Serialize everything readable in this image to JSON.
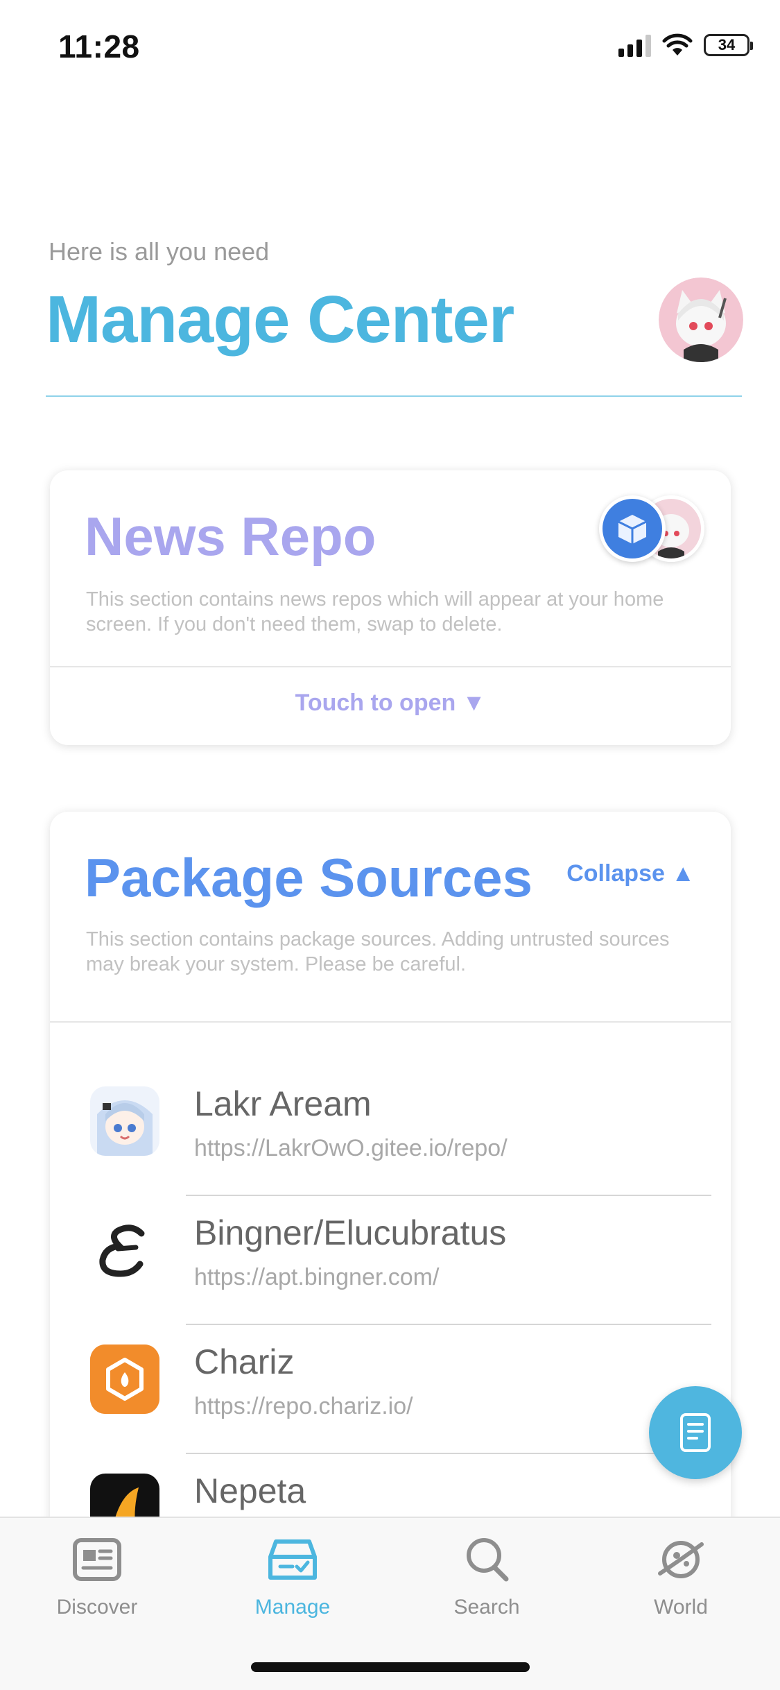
{
  "status_bar": {
    "time": "11:28",
    "battery": "34"
  },
  "header": {
    "subtitle": "Here is all you need",
    "title": "Manage Center"
  },
  "news_card": {
    "title": "News Repo",
    "description": "This section contains news repos which will appear at your home screen. If you don't need them, swap to delete.",
    "open_label": "Touch to open ▼"
  },
  "package_card": {
    "title": "Package Sources",
    "collapse_label": "Collapse ▲",
    "description": "This section contains package sources. Adding untrusted sources may break your system. Please be careful.",
    "repos": [
      {
        "name": "Lakr Aream",
        "url": "https://LakrOwO.gitee.io/repo/",
        "icon": "anime-girl-icon"
      },
      {
        "name": "Bingner/Elucubratus",
        "url": "https://apt.bingner.com/",
        "icon": "elucubratus-e-icon"
      },
      {
        "name": "Chariz",
        "url": "https://repo.chariz.io/",
        "icon": "chariz-icon"
      },
      {
        "name": "Nepeta",
        "url": "",
        "icon": "nepeta-icon"
      }
    ]
  },
  "tabs": [
    {
      "label": "Discover",
      "icon": "newspaper-icon",
      "active": false
    },
    {
      "label": "Manage",
      "icon": "tray-check-icon",
      "active": true
    },
    {
      "label": "Search",
      "icon": "magnifier-icon",
      "active": false
    },
    {
      "label": "World",
      "icon": "planet-icon",
      "active": false
    }
  ],
  "colors": {
    "accent": "#4cb6df",
    "news_purple": "#a9a6ee",
    "package_blue": "#5b93ee"
  }
}
